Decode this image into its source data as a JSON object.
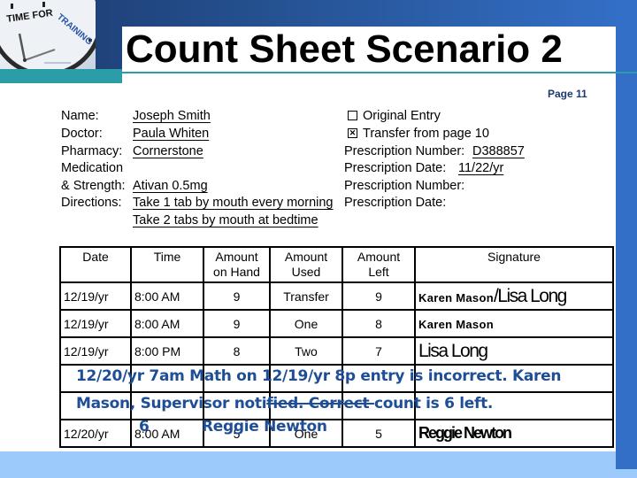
{
  "slide": {
    "title": "Count Sheet Scenario 2",
    "page_label": "Page 11",
    "logo": {
      "text_top": "TIME FOR",
      "text_accent": "TRAINING",
      "icon": "clock-icon"
    }
  },
  "form": {
    "left": [
      {
        "label": "Name:",
        "value": "Joseph Smith"
      },
      {
        "label": "Doctor:",
        "value": "Paula Whiten"
      },
      {
        "label": "Pharmacy:",
        "value": "Cornerstone"
      },
      {
        "label": "Medication",
        "value": ""
      },
      {
        "label": "& Strength:",
        "value": "Ativan 0.5mg "
      },
      {
        "label": "Directions:",
        "value": "Take 1 tab by mouth every morning"
      },
      {
        "label": "",
        "value": "Take 2 tabs by mouth at bedtime"
      }
    ],
    "right": {
      "original_entry": {
        "label": "Original Entry",
        "checked": false,
        "mark": ""
      },
      "transfer": {
        "label": "Transfer  from page 10",
        "checked": true,
        "mark": "✕"
      },
      "rx_number_1": {
        "label": "Prescription Number:",
        "value": "D388857"
      },
      "rx_date_1": {
        "label": "Prescription Date:",
        "value": "11/22/yr"
      },
      "rx_number_2": {
        "label": "Prescription Number:",
        "value": ""
      },
      "rx_date_2": {
        "label": "Prescription Date:",
        "value": ""
      }
    }
  },
  "table": {
    "headers": [
      "Date",
      "Time",
      "Amount on Hand",
      "Amount Used",
      "Amount Left",
      "Signature"
    ],
    "header_lines": [
      [
        "Date"
      ],
      [
        "Time"
      ],
      [
        "Amount",
        "on Hand"
      ],
      [
        "Amount",
        "Used"
      ],
      [
        "Amount",
        "Left"
      ],
      [
        "Signature"
      ]
    ],
    "rows": [
      {
        "date": "12/19/yr",
        "time": "8:00 AM",
        "on_hand": "9",
        "used": "Transfer",
        "left": "9",
        "sig_a": "Karen Mason",
        "sig_b": "/Lisa Long"
      },
      {
        "date": "12/19/yr",
        "time": "8:00 AM",
        "on_hand": "9",
        "used": "One",
        "left": "8",
        "sig_a": "Karen Mason",
        "sig_b": ""
      },
      {
        "date": "12/19/yr",
        "time": "8:00 PM",
        "on_hand": "8",
        "used": "Two",
        "left": "7",
        "sig_a": "",
        "sig_b": "Lisa Long"
      },
      {
        "date": "",
        "time": "",
        "on_hand": "",
        "used": "",
        "left": "",
        "sig_a": "",
        "sig_b": ""
      },
      {
        "date": "",
        "time": "",
        "on_hand": "",
        "used": "",
        "left": "",
        "sig_a": "",
        "sig_b": ""
      },
      {
        "date": "12/20/yr",
        "time": "8:00 AM",
        "on_hand": "5",
        "used": "One",
        "left": "5",
        "sig_a": "",
        "sig_b": "Reggie Newton"
      }
    ]
  },
  "annotation": {
    "line1": "12/20/yr 7am Math on 12/19/yr 8p entry is incorrect. Karen",
    "line2_a": "Mason, Supervisor noti",
    "line2_strike": "fied. Correct ",
    "line2_b": "count is 6 left.",
    "correction_value": "6",
    "signature": "Reggie Newton",
    "color": "#1e4e96"
  },
  "colors": {
    "header_dark": "#1d3a6e",
    "header_light": "#3470c8",
    "teal": "#2a9da6",
    "bottom_band": "#9ccafb"
  }
}
